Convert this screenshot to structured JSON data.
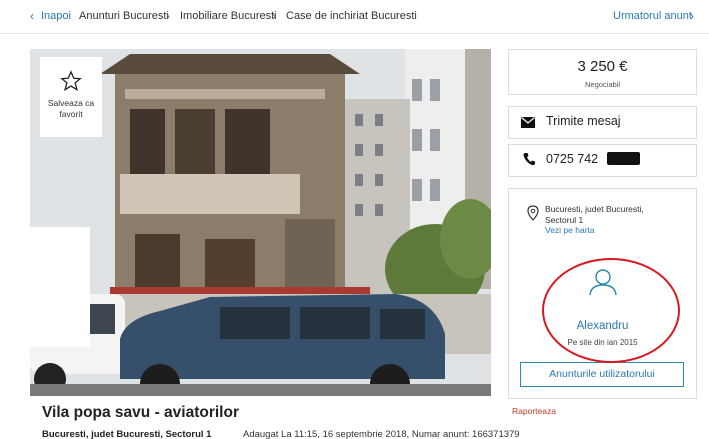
{
  "breadcrumb": {
    "back": "Inapoi",
    "items": [
      "Anunturi Bucuresti",
      "Imobiliare Bucuresti",
      "Case de inchiriat Bucuresti"
    ],
    "next": "Urmatorul anunt"
  },
  "gallery": {
    "favorite_label": "Salveaza ca favorit"
  },
  "listing": {
    "title": "Vila popa savu - aviatorilor",
    "location": "Bucuresti, judet Bucuresti, Sectorul 1",
    "added": "Adaugat La 11:15, 16 septembrie 2018, Numar anunt: 166371379"
  },
  "sidebar": {
    "price": "3 250 €",
    "negotiable": "Negociabil",
    "send_message": "Trimite mesaj",
    "phone": "0725 742",
    "address_line1": "Bucuresti, judet Bucuresti,",
    "address_line2": "Sectorul 1",
    "map_link": "Vezi pe harta",
    "user_name": "Alexandru",
    "member_since": "Pe site din ian 2015",
    "user_ads_button": "Anunturile utilizatorului",
    "report": "Raporteaza"
  },
  "colors": {
    "link": "#2a78b4",
    "annotation_circle": "#d8191f",
    "report": "#c0392b"
  }
}
